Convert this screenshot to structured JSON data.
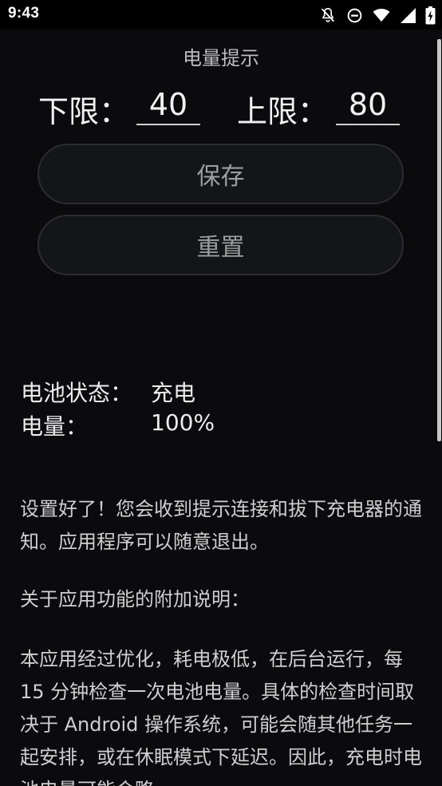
{
  "status_bar": {
    "time": "9:43",
    "icons": [
      "notifications-off-icon",
      "do-not-disturb-icon",
      "wifi-icon",
      "signal-icon",
      "battery-charging-icon"
    ]
  },
  "header": {
    "title": "电量提示"
  },
  "limits": {
    "lower_label": "下限：",
    "lower_value": "40",
    "upper_label": "上限：",
    "upper_value": "80"
  },
  "buttons": {
    "save_label": "保存",
    "reset_label": "重置"
  },
  "battery": {
    "state_label": "电池状态：",
    "state_value": "充电",
    "level_label": "电量：",
    "level_value": "100%"
  },
  "description": {
    "p1": "设置好了！您会收到提示连接和拔下充电器的通知。应用程序可以随意退出。",
    "p2": "关于应用功能的附加说明：",
    "p3": "本应用经过优化，耗电极低，在后台运行，每 15 分钟检查一次电池电量。具体的检查时间取决于 Android 操作系统，可能会随其他任务一起安排，或在休眠模式下延迟。因此，充电时电池电量可能会略"
  },
  "colors": {
    "background": "#0b0b0e",
    "button_fill": "#141519",
    "button_border": "#2a2c31"
  }
}
